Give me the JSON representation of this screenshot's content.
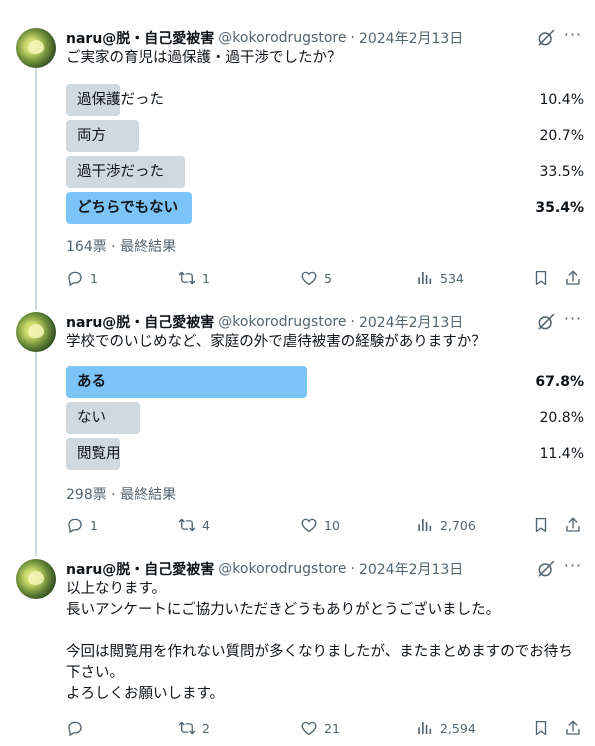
{
  "tweets": [
    {
      "author": {
        "name": "naru@脱・自己愛被害",
        "handle": "@kokorodrugstore",
        "sep": "·",
        "date": "2024年2月13日"
      },
      "text": "ご実家の育児は過保護・過干渉でしたか？",
      "poll": {
        "options": [
          {
            "label": "過保護だった",
            "percent": "10.4%",
            "value": 10.4,
            "winner": false
          },
          {
            "label": "両方",
            "percent": "20.7%",
            "value": 20.7,
            "winner": false
          },
          {
            "label": "過干渉だった",
            "percent": "33.5%",
            "value": 33.5,
            "winner": false
          },
          {
            "label": "どちらでもない",
            "percent": "35.4%",
            "value": 35.4,
            "winner": true
          }
        ],
        "meta": "164票 · 最終結果"
      },
      "actions": {
        "replies": "1",
        "reposts": "1",
        "likes": "5",
        "views": "534"
      }
    },
    {
      "author": {
        "name": "naru@脱・自己愛被害",
        "handle": "@kokorodrugstore",
        "sep": "·",
        "date": "2024年2月13日"
      },
      "text": "学校でのいじめなど、家庭の外で虐待被害の経験がありますか？",
      "poll": {
        "options": [
          {
            "label": "ある",
            "percent": "67.8%",
            "value": 67.8,
            "winner": true
          },
          {
            "label": "ない",
            "percent": "20.8%",
            "value": 20.8,
            "winner": false
          },
          {
            "label": "閲覧用",
            "percent": "11.4%",
            "value": 11.4,
            "winner": false
          }
        ],
        "meta": "298票 · 最終結果"
      },
      "actions": {
        "replies": "1",
        "reposts": "4",
        "likes": "10",
        "views": "2,706"
      }
    },
    {
      "author": {
        "name": "naru@脱・自己愛被害",
        "handle": "@kokorodrugstore",
        "sep": "·",
        "date": "2024年2月13日"
      },
      "text": "以上なります。\n長いアンケートにご協力いただきどうもありがとうございました。\n\n今回は閲覧用を作れない質問が多くなりましたが、またまとめますのでお待ち下さい。\nよろしくお願いします。",
      "actions": {
        "replies": "",
        "reposts": "2",
        "likes": "21",
        "views": "2,594"
      }
    }
  ],
  "icons": {
    "reply": "reply-icon",
    "repost": "repost-icon",
    "like": "heart-icon",
    "views": "views-icon",
    "bookmark": "bookmark-icon",
    "share": "share-icon",
    "grok": "grok-icon",
    "more": "more-icon"
  },
  "colors": {
    "winner_bar": "#7cc4f8",
    "bar": "#cfd9de",
    "secondary_text": "#536471"
  }
}
